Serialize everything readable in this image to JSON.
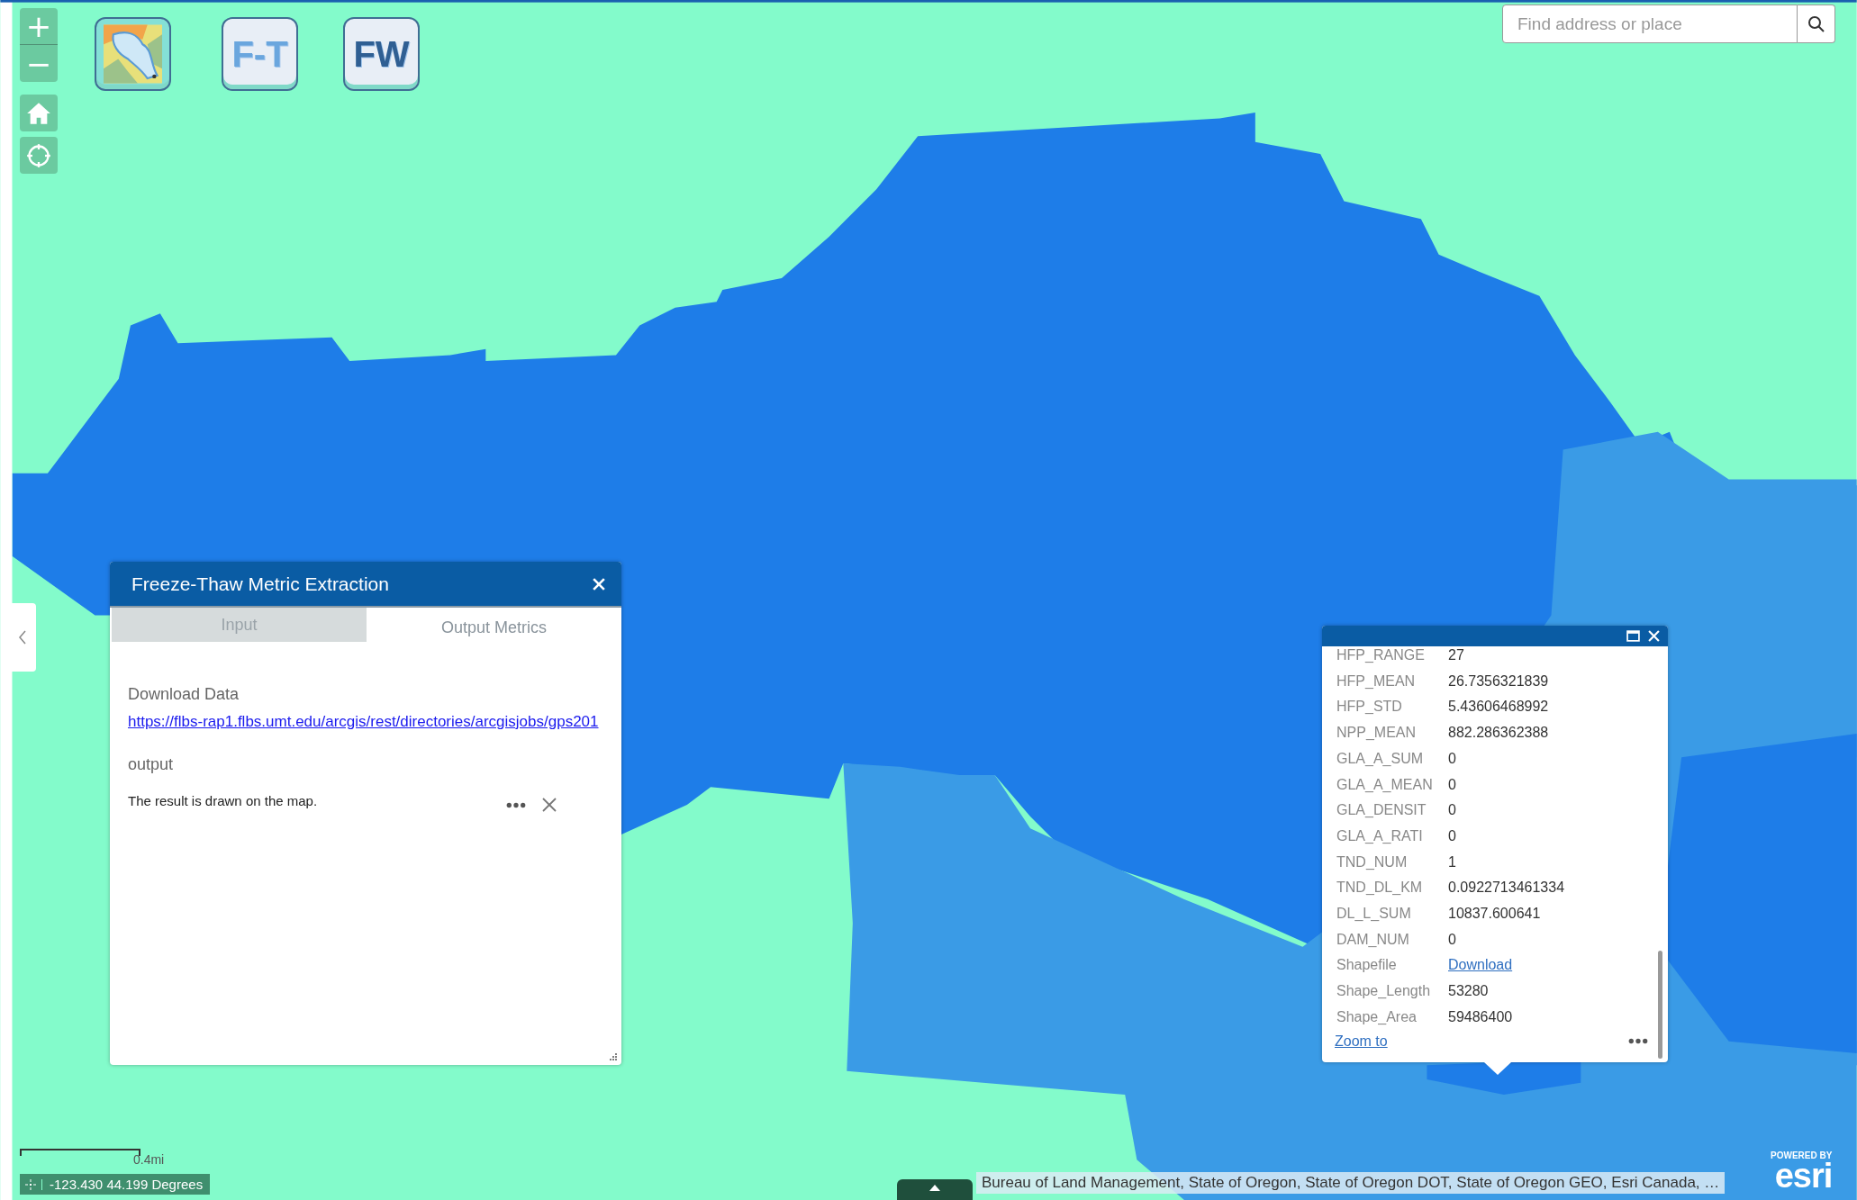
{
  "map_controls": {
    "zoom_in": "+",
    "zoom_out": "−"
  },
  "toolbar": [
    {
      "kind": "icon"
    },
    {
      "kind": "text",
      "label": "F-T"
    },
    {
      "kind": "text",
      "label": "FW"
    }
  ],
  "search": {
    "placeholder": "Find address or place"
  },
  "panel": {
    "title": "Freeze-Thaw Metric Extraction",
    "tabs": [
      {
        "label": "Input",
        "selected": false
      },
      {
        "label": "Output Metrics",
        "selected": true
      }
    ],
    "section_title": "Download Data",
    "link": "https://flbs-rap1.flbs.umt.edu/arcgis/rest/directories/arcgisjobs/gps201",
    "output_label": "output",
    "result_text": "The result is drawn on the map."
  },
  "popup": {
    "rows": [
      {
        "label": "HFP_RANGE",
        "value": "27",
        "kind": "text"
      },
      {
        "label": "HFP_MEAN",
        "value": "26.7356321839",
        "kind": "text"
      },
      {
        "label": "HFP_STD",
        "value": "5.43606468992",
        "kind": "text"
      },
      {
        "label": "NPP_MEAN",
        "value": "882.286362388",
        "kind": "text"
      },
      {
        "label": "GLA_A_SUM",
        "value": "0",
        "kind": "text"
      },
      {
        "label": "GLA_A_MEAN",
        "value": "0",
        "kind": "text"
      },
      {
        "label": "GLA_DENSIT",
        "value": "0",
        "kind": "text"
      },
      {
        "label": "GLA_A_RATI",
        "value": "0",
        "kind": "text"
      },
      {
        "label": "TND_NUM",
        "value": "1",
        "kind": "text"
      },
      {
        "label": "TND_DL_KM",
        "value": "0.0922713461334",
        "kind": "text"
      },
      {
        "label": "DL_L_SUM",
        "value": "10837.600641",
        "kind": "text"
      },
      {
        "label": "DAM_NUM",
        "value": "0",
        "kind": "text"
      },
      {
        "label": "Shapefile",
        "value": "Download",
        "kind": "link"
      },
      {
        "label": "Shape_Length",
        "value": "53280",
        "kind": "text"
      },
      {
        "label": "Shape_Area",
        "value": "59486400",
        "kind": "text"
      }
    ],
    "action": "Zoom to"
  },
  "scale": "0.4mi",
  "coordinates": "-123.430 44.199 Degrees",
  "attribution": "Bureau of Land Management, State of Oregon, State of Oregon DOT, State of Oregon GEO, Esri Canada, …",
  "logo": {
    "caption": "POWERED BY",
    "name": "esri"
  }
}
